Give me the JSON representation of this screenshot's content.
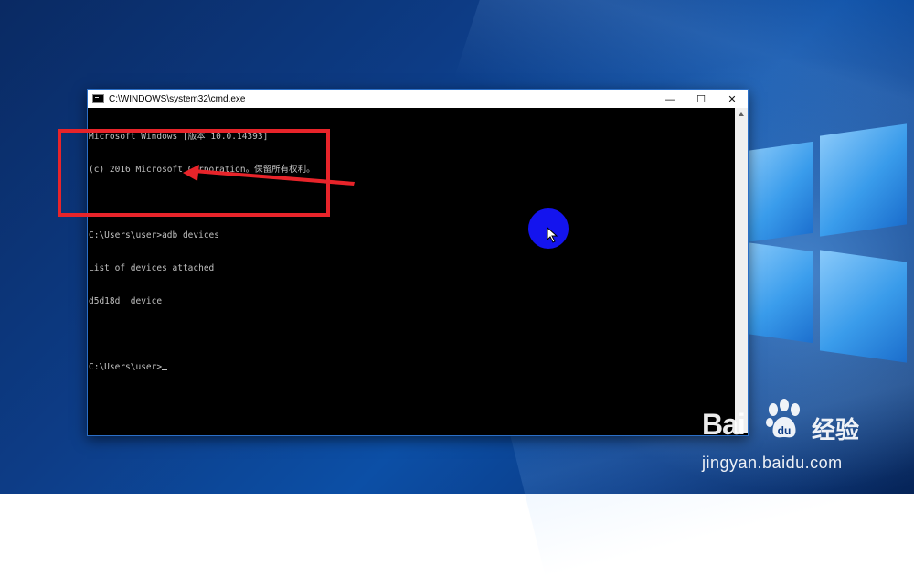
{
  "window": {
    "title": "C:\\WINDOWS\\system32\\cmd.exe",
    "controls": {
      "minimize": "—",
      "maximize": "☐",
      "close": "✕"
    }
  },
  "console": {
    "lines": [
      "Microsoft Windows [版本 10.0.14393]",
      "(c) 2016 Microsoft Corporation。保留所有权利。",
      "",
      "C:\\Users\\user>adb devices",
      "List of devices attached",
      "d5d18d  device",
      "",
      "C:\\Users\\user>"
    ]
  },
  "annotation": {
    "box_color": "#e8242a",
    "highlight_color": "#1414ee"
  },
  "watermark": {
    "brand": "Bai",
    "brand_cn": "经验",
    "url": "jingyan.baidu.com"
  },
  "icons": [
    "cmd-app-icon",
    "minimize-icon",
    "maximize-icon",
    "close-icon",
    "mouse-pointer-icon",
    "baidu-paw-icon"
  ]
}
